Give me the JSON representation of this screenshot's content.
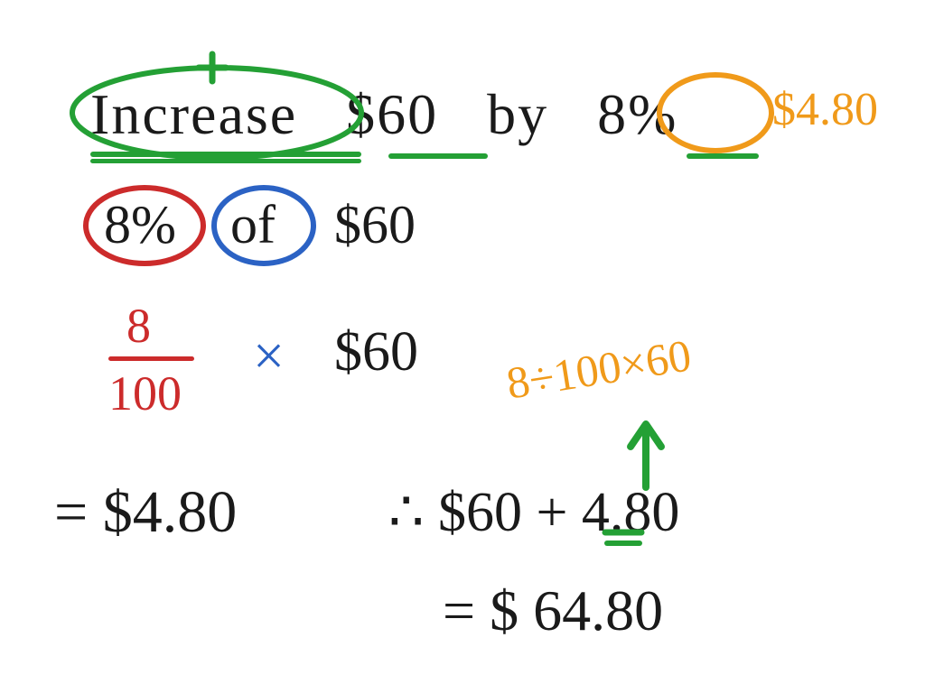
{
  "problem": {
    "title_word": "Increase",
    "amount": "$60",
    "by": "by",
    "percent": "8%",
    "increase_value": "$4.80"
  },
  "step_pct_of": {
    "pct": "8%",
    "of": "of",
    "amount": "$60"
  },
  "fraction": {
    "numerator": "8",
    "denominator": "100",
    "times": "×",
    "amount": "$60"
  },
  "alt_calc": "8÷100×60",
  "result_480": "= $4.80",
  "therefore_line": "∴ $60 + 4.80",
  "plus_sign": "+",
  "final": "= $ 64.80",
  "colors": {
    "black": "#1a1a1a",
    "red": "#cc2b2b",
    "blue": "#2b62c4",
    "green": "#24a035",
    "orange": "#f09a1a"
  }
}
